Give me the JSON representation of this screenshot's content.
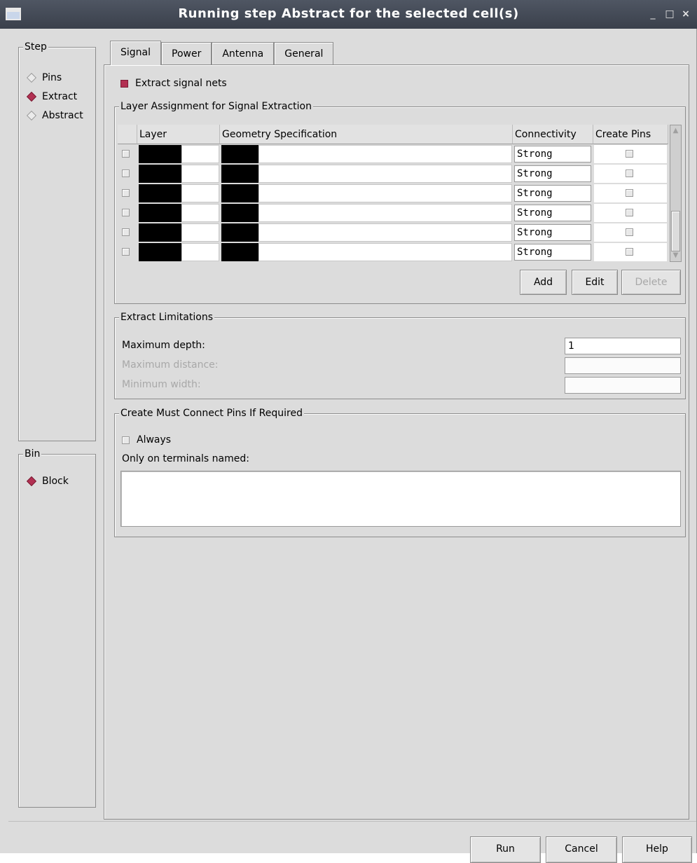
{
  "window": {
    "title": "Running step Abstract for the selected cell(s)",
    "minimize_glyph": "_",
    "maximize_glyph": "□",
    "close_glyph": "×"
  },
  "step_panel": {
    "legend": "Step",
    "options": [
      {
        "label": "Pins",
        "selected": false
      },
      {
        "label": "Extract",
        "selected": true
      },
      {
        "label": "Abstract",
        "selected": false
      }
    ]
  },
  "bin_panel": {
    "legend": "Bin",
    "options": [
      {
        "label": "Block",
        "selected": true
      }
    ]
  },
  "tabs": [
    "Signal",
    "Power",
    "Antenna",
    "General"
  ],
  "active_tab": "Signal",
  "signal": {
    "extract_signal_nets": {
      "label": "Extract signal nets",
      "checked": true
    },
    "layer_assignment": {
      "legend": "Layer Assignment for Signal Extraction",
      "columns": [
        "Layer",
        "Geometry Specification",
        "Connectivity",
        "Create Pins"
      ],
      "rows": [
        {
          "connectivity": "Strong"
        },
        {
          "connectivity": "Strong"
        },
        {
          "connectivity": "Strong"
        },
        {
          "connectivity": "Strong"
        },
        {
          "connectivity": "Strong"
        },
        {
          "connectivity": "Strong"
        }
      ],
      "buttons": {
        "add": "Add",
        "edit": "Edit",
        "delete": "Delete"
      }
    },
    "extract_limitations": {
      "legend": "Extract Limitations",
      "maximum_depth_label": "Maximum depth:",
      "maximum_depth_value": "1",
      "maximum_distance_label": "Maximum distance:",
      "maximum_distance_value": "",
      "minimum_width_label": "Minimum width:",
      "minimum_width_value": ""
    },
    "must_connect": {
      "legend": "Create Must Connect Pins If Required",
      "always_label": "Always",
      "always_checked": false,
      "terminals_label": "Only on terminals named:",
      "terminals_value": ""
    }
  },
  "footer": {
    "run": "Run",
    "cancel": "Cancel",
    "help": "Help"
  }
}
